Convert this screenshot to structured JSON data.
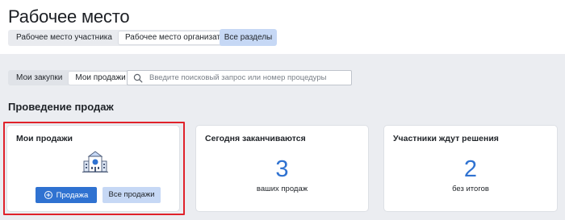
{
  "header": {
    "title": "Рабочее место",
    "tabs": [
      {
        "label": "Рабочее место участника",
        "active": false
      },
      {
        "label": "Рабочее место организатора",
        "active": true
      }
    ],
    "all_sections_label": "Все разделы"
  },
  "filters": {
    "tabs": [
      {
        "label": "Мои закупки",
        "active": false
      },
      {
        "label": "Мои продажи",
        "active": true
      }
    ],
    "search_placeholder": "Введите поисковый запрос или номер процедуры"
  },
  "section": {
    "title": "Проведение продаж"
  },
  "cards": {
    "my_sales": {
      "title": "Мои продажи",
      "primary_button": "Продажа",
      "secondary_button": "Все продажи",
      "highlight_color": "#e0222b"
    },
    "ending_today": {
      "title": "Сегодня заканчиваются",
      "count": "3",
      "caption": "ваших продаж"
    },
    "awaiting_decision": {
      "title": "Участники ждут решения",
      "count": "2",
      "caption": "без итогов"
    }
  },
  "colors": {
    "accent": "#2f72d1",
    "accent_light": "#c6d8f5",
    "background": "#ebedf1"
  }
}
